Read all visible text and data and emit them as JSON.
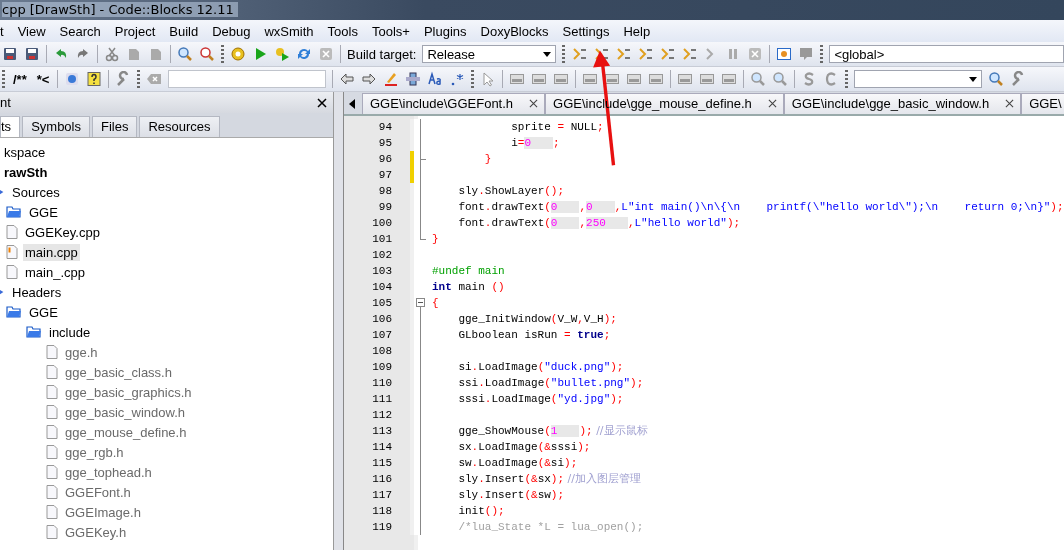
{
  "window": {
    "title": "cpp [DrawSth] - Code::Blocks 12.11"
  },
  "menu": [
    "t",
    "View",
    "Search",
    "Project",
    "Build",
    "Debug",
    "wxSmith",
    "Tools",
    "Tools+",
    "Plugins",
    "DoxyBlocks",
    "Settings",
    "Help"
  ],
  "toolbar": {
    "build_target_label": "Build target:",
    "build_target": "Release",
    "scope": "<global>",
    "doc_buttons": [
      "/**",
      "*<"
    ]
  },
  "management": {
    "title": "nt",
    "tabs": [
      {
        "label": "ts",
        "selected": true
      },
      {
        "label": "Symbols",
        "selected": false
      },
      {
        "label": "Files",
        "selected": false
      },
      {
        "label": "Resources",
        "selected": false
      }
    ],
    "tree": [
      {
        "kind": "workspace",
        "label": "kspace",
        "children": [
          {
            "kind": "project",
            "label": "rawSth",
            "children": [
              {
                "kind": "group",
                "label": "Sources",
                "children": [
                  {
                    "kind": "folder",
                    "label": "GGE"
                  },
                  {
                    "kind": "file",
                    "label": "GGEKey.cpp",
                    "selected": false,
                    "greyed": false,
                    "modified": false
                  },
                  {
                    "kind": "file",
                    "label": "main.cpp",
                    "selected": true,
                    "greyed": false,
                    "modified": true
                  },
                  {
                    "kind": "file",
                    "label": "main_.cpp",
                    "selected": false,
                    "greyed": false,
                    "modified": false
                  }
                ]
              },
              {
                "kind": "group",
                "label": "Headers",
                "children": [
                  {
                    "kind": "folder",
                    "label": "GGE",
                    "children": [
                      {
                        "kind": "folder",
                        "label": "include",
                        "children": [
                          {
                            "kind": "file",
                            "label": "gge.h",
                            "selected": false,
                            "greyed": true,
                            "modified": false
                          },
                          {
                            "kind": "file",
                            "label": "gge_basic_class.h",
                            "selected": false,
                            "greyed": true,
                            "modified": false
                          },
                          {
                            "kind": "file",
                            "label": "gge_basic_graphics.h",
                            "selected": false,
                            "greyed": true,
                            "modified": false
                          },
                          {
                            "kind": "file",
                            "label": "gge_basic_window.h",
                            "selected": false,
                            "greyed": true,
                            "modified": false
                          },
                          {
                            "kind": "file",
                            "label": "gge_mouse_define.h",
                            "selected": false,
                            "greyed": true,
                            "modified": false
                          },
                          {
                            "kind": "file",
                            "label": "gge_rgb.h",
                            "selected": false,
                            "greyed": true,
                            "modified": false
                          },
                          {
                            "kind": "file",
                            "label": "gge_tophead.h",
                            "selected": false,
                            "greyed": true,
                            "modified": false
                          },
                          {
                            "kind": "file",
                            "label": "GGEFont.h",
                            "selected": false,
                            "greyed": true,
                            "modified": false
                          },
                          {
                            "kind": "file",
                            "label": "GGEImage.h",
                            "selected": false,
                            "greyed": true,
                            "modified": false
                          },
                          {
                            "kind": "file",
                            "label": "GGEKey.h",
                            "selected": false,
                            "greyed": true,
                            "modified": false
                          }
                        ]
                      }
                    ]
                  }
                ]
              }
            ]
          }
        ]
      }
    ]
  },
  "editor": {
    "tabs": [
      "GGE\\include\\GGEFont.h",
      "GGE\\include\\gge_mouse_define.h",
      "GGE\\include\\gge_basic_window.h",
      "GGE\\"
    ],
    "lines": [
      {
        "number": "94",
        "changed": false,
        "kind": "line",
        "tokens": [
          {
            "kind": "id",
            "t": "            sprite"
          },
          {
            "kind": "op",
            "t": " ="
          },
          {
            "kind": "id",
            "t": " NULL"
          },
          {
            "kind": "op",
            "t": ";"
          }
        ]
      },
      {
        "number": "95",
        "changed": false,
        "kind": "line",
        "tokens": [
          {
            "kind": "id",
            "t": "            i"
          },
          {
            "kind": "op",
            "t": "="
          },
          {
            "kind": "num",
            "t": "0"
          },
          {
            "kind": "op",
            "t": ";"
          }
        ]
      },
      {
        "number": "96",
        "changed": true,
        "kind": "branch",
        "tokens": [
          {
            "kind": "op",
            "t": "        }"
          }
        ]
      },
      {
        "number": "97",
        "changed": true,
        "kind": "line"
      },
      {
        "number": "98",
        "changed": false,
        "kind": "line",
        "tokens": [
          {
            "kind": "id",
            "t": "    sly"
          },
          {
            "kind": "op",
            "t": "."
          },
          {
            "kind": "id",
            "t": "ShowLayer"
          },
          {
            "kind": "op",
            "t": "();"
          }
        ]
      },
      {
        "number": "99",
        "changed": false,
        "kind": "line",
        "tokens": [
          {
            "kind": "id",
            "t": "    font"
          },
          {
            "kind": "op",
            "t": "."
          },
          {
            "kind": "id",
            "t": "drawText"
          },
          {
            "kind": "op",
            "t": "("
          },
          {
            "kind": "num",
            "t": "0"
          },
          {
            "kind": "op",
            "t": ","
          },
          {
            "kind": "num",
            "t": "0"
          },
          {
            "kind": "op",
            "t": ","
          },
          {
            "kind": "str",
            "t": "L\"int main()\\n\\{\\n    printf(\\\"hello world\\\");\\n    return 0;\\n}\""
          },
          {
            "kind": "op",
            "t": ");"
          }
        ]
      },
      {
        "number": "100",
        "changed": false,
        "kind": "line",
        "tokens": [
          {
            "kind": "id",
            "t": "    font"
          },
          {
            "kind": "op",
            "t": "."
          },
          {
            "kind": "id",
            "t": "drawText"
          },
          {
            "kind": "op",
            "t": "("
          },
          {
            "kind": "num",
            "t": "0"
          },
          {
            "kind": "op",
            "t": ","
          },
          {
            "kind": "num",
            "t": "250"
          },
          {
            "kind": "op",
            "t": ","
          },
          {
            "kind": "str",
            "t": "L\"hello world\""
          },
          {
            "kind": "op",
            "t": ");"
          }
        ]
      },
      {
        "number": "101",
        "changed": false,
        "kind": "end",
        "tokens": [
          {
            "kind": "op",
            "t": "}"
          }
        ]
      },
      {
        "number": "102",
        "changed": false,
        "kind": "none"
      },
      {
        "number": "103",
        "changed": false,
        "kind": "none",
        "tokens": [
          {
            "kind": "pre",
            "t": "#undef main"
          }
        ]
      },
      {
        "number": "104",
        "changed": false,
        "kind": "none",
        "tokens": [
          {
            "kind": "kw",
            "t": "int"
          },
          {
            "kind": "id",
            "t": " main"
          },
          {
            "kind": "op",
            "t": " ()"
          }
        ]
      },
      {
        "number": "105",
        "changed": false,
        "kind": "start",
        "tokens": [
          {
            "kind": "op",
            "t": "{"
          }
        ]
      },
      {
        "number": "106",
        "changed": false,
        "kind": "line",
        "tokens": [
          {
            "kind": "id",
            "t": "    gge_InitWindow"
          },
          {
            "kind": "op",
            "t": "("
          },
          {
            "kind": "id",
            "t": "V_W"
          },
          {
            "kind": "op",
            "t": ","
          },
          {
            "kind": "id",
            "t": "V_H"
          },
          {
            "kind": "op",
            "t": ");"
          }
        ]
      },
      {
        "number": "107",
        "changed": false,
        "kind": "line",
        "tokens": [
          {
            "kind": "id",
            "t": "    GLboolean isRun"
          },
          {
            "kind": "op",
            "t": " ="
          },
          {
            "kind": "kw",
            "t": " true"
          },
          {
            "kind": "op",
            "t": ";"
          }
        ]
      },
      {
        "number": "108",
        "changed": false,
        "kind": "line"
      },
      {
        "number": "109",
        "changed": false,
        "kind": "line",
        "tokens": [
          {
            "kind": "id",
            "t": "    si"
          },
          {
            "kind": "op",
            "t": "."
          },
          {
            "kind": "id",
            "t": "LoadImage"
          },
          {
            "kind": "op",
            "t": "("
          },
          {
            "kind": "str",
            "t": "\"duck.png\""
          },
          {
            "kind": "op",
            "t": ");"
          }
        ]
      },
      {
        "number": "110",
        "changed": false,
        "kind": "line",
        "tokens": [
          {
            "kind": "id",
            "t": "    ssi"
          },
          {
            "kind": "op",
            "t": "."
          },
          {
            "kind": "id",
            "t": "LoadImage"
          },
          {
            "kind": "op",
            "t": "("
          },
          {
            "kind": "str",
            "t": "\"bullet.png\""
          },
          {
            "kind": "op",
            "t": ");"
          }
        ]
      },
      {
        "number": "111",
        "changed": false,
        "kind": "line",
        "tokens": [
          {
            "kind": "id",
            "t": "    sssi"
          },
          {
            "kind": "op",
            "t": "."
          },
          {
            "kind": "id",
            "t": "LoadImage"
          },
          {
            "kind": "op",
            "t": "("
          },
          {
            "kind": "str",
            "t": "\"yd.jpg\""
          },
          {
            "kind": "op",
            "t": ");"
          }
        ]
      },
      {
        "number": "112",
        "changed": false,
        "kind": "line"
      },
      {
        "number": "113",
        "changed": false,
        "kind": "line",
        "tokens": [
          {
            "kind": "id",
            "t": "    gge_ShowMouse"
          },
          {
            "kind": "op",
            "t": "("
          },
          {
            "kind": "num",
            "t": "1"
          },
          {
            "kind": "op",
            "t": ");"
          },
          {
            "kind": "cmt",
            "t": " //显示鼠标"
          }
        ]
      },
      {
        "number": "114",
        "changed": false,
        "kind": "line",
        "tokens": [
          {
            "kind": "id",
            "t": "    sx"
          },
          {
            "kind": "op",
            "t": "."
          },
          {
            "kind": "id",
            "t": "LoadImage"
          },
          {
            "kind": "op",
            "t": "(&"
          },
          {
            "kind": "id",
            "t": "sssi"
          },
          {
            "kind": "op",
            "t": ");"
          }
        ]
      },
      {
        "number": "115",
        "changed": false,
        "kind": "line",
        "tokens": [
          {
            "kind": "id",
            "t": "    sw"
          },
          {
            "kind": "op",
            "t": "."
          },
          {
            "kind": "id",
            "t": "LoadImage"
          },
          {
            "kind": "op",
            "t": "(&"
          },
          {
            "kind": "id",
            "t": "si"
          },
          {
            "kind": "op",
            "t": ");"
          }
        ]
      },
      {
        "number": "116",
        "changed": false,
        "kind": "line",
        "tokens": [
          {
            "kind": "id",
            "t": "    sly"
          },
          {
            "kind": "op",
            "t": "."
          },
          {
            "kind": "id",
            "t": "Insert"
          },
          {
            "kind": "op",
            "t": "(&"
          },
          {
            "kind": "id",
            "t": "sx"
          },
          {
            "kind": "op",
            "t": ");"
          },
          {
            "kind": "cmt",
            "t": " //加入图层管理"
          }
        ]
      },
      {
        "number": "117",
        "changed": false,
        "kind": "line",
        "tokens": [
          {
            "kind": "id",
            "t": "    sly"
          },
          {
            "kind": "op",
            "t": "."
          },
          {
            "kind": "id",
            "t": "Insert"
          },
          {
            "kind": "op",
            "t": "(&"
          },
          {
            "kind": "id",
            "t": "sw"
          },
          {
            "kind": "op",
            "t": ");"
          }
        ]
      },
      {
        "number": "118",
        "changed": false,
        "kind": "line",
        "tokens": [
          {
            "kind": "id",
            "t": "    init"
          },
          {
            "kind": "op",
            "t": "();"
          }
        ]
      },
      {
        "number": "119",
        "changed": false,
        "kind": "line",
        "tokens": [
          {
            "kind": "doc",
            "t": "    /*lua_State *L = lua_open();"
          }
        ]
      }
    ]
  }
}
